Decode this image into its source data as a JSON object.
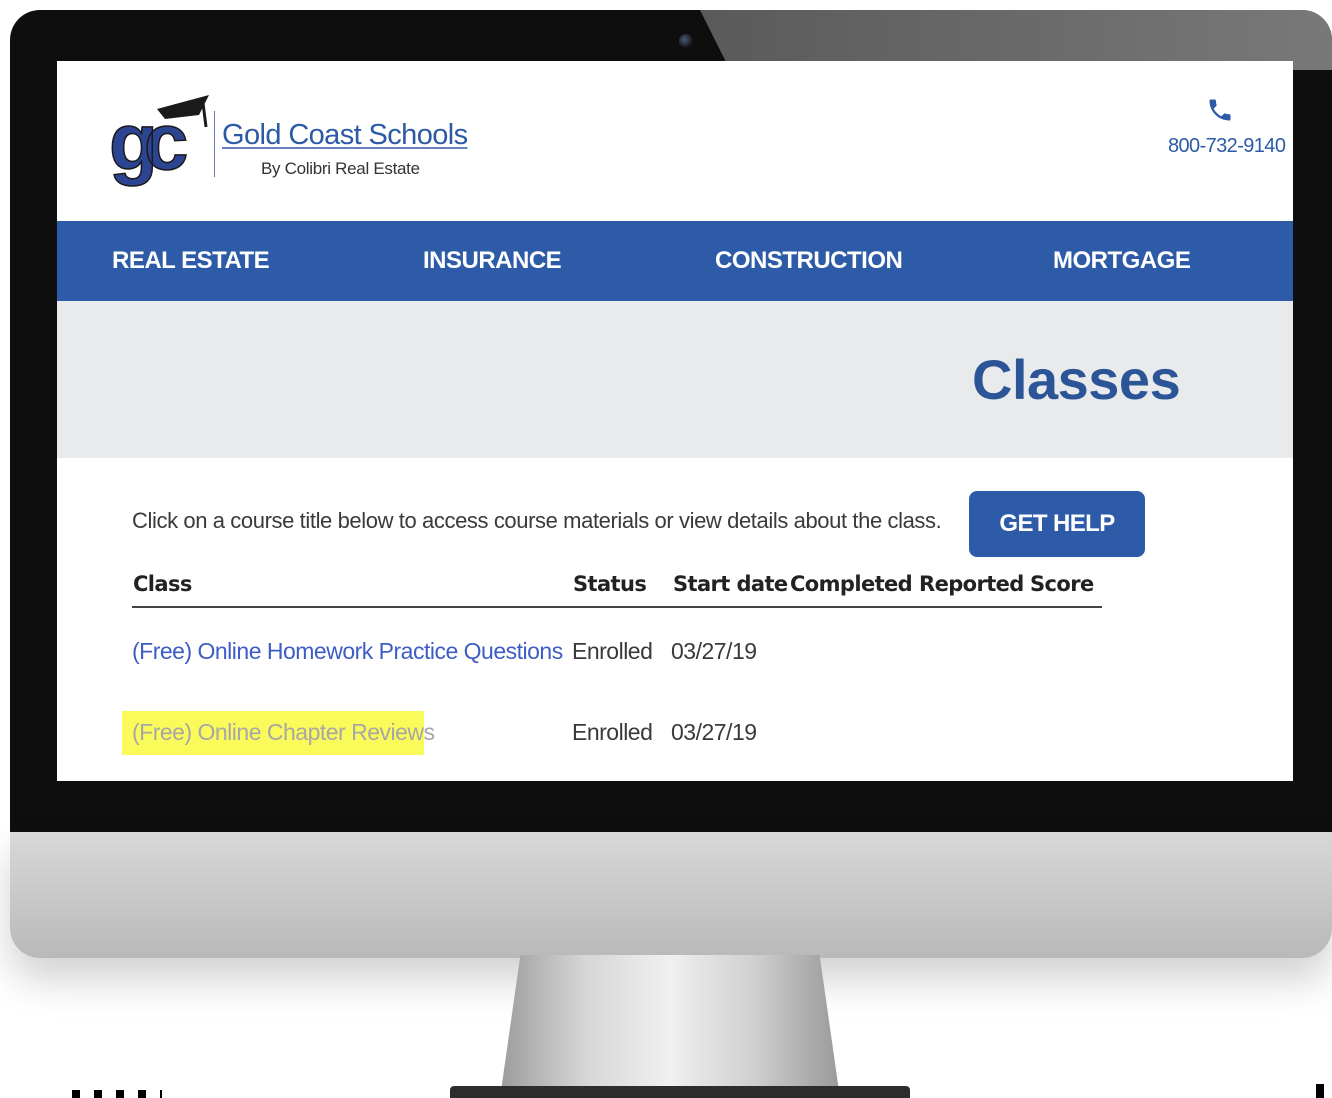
{
  "brand": {
    "logo_letters": "gc",
    "name": "Gold Coast Schools",
    "subtitle": "By Colibri Real Estate",
    "phone": "800-732-9140",
    "phone_icon": "phone-icon"
  },
  "nav": {
    "items": [
      {
        "label": "REAL ESTATE"
      },
      {
        "label": "INSURANCE"
      },
      {
        "label": "CONSTRUCTION"
      },
      {
        "label": "MORTGAGE"
      }
    ]
  },
  "banner": {
    "title": "Classes"
  },
  "content": {
    "instructions": "Click on a course title below to access course materials or view details about the class.",
    "help_button": "GET HELP"
  },
  "table": {
    "columns": [
      "Class",
      "Status",
      "Start date",
      "Completed",
      "Reported",
      "Score"
    ],
    "rows": [
      {
        "class": "(Free) Online Homework Practice Questions",
        "status": "Enrolled",
        "start_date": "03/27/19",
        "completed": "",
        "reported": "",
        "score": "",
        "highlighted": false
      },
      {
        "class": "(Free) Online Chapter Reviews",
        "status": "Enrolled",
        "start_date": "03/27/19",
        "completed": "",
        "reported": "",
        "score": "",
        "highlighted": true
      }
    ]
  },
  "colors": {
    "brand_blue": "#2e5ba8",
    "link_blue": "#3d5cc5",
    "highlight": "#fafa5a",
    "banner_bg": "#e9eaeb"
  }
}
